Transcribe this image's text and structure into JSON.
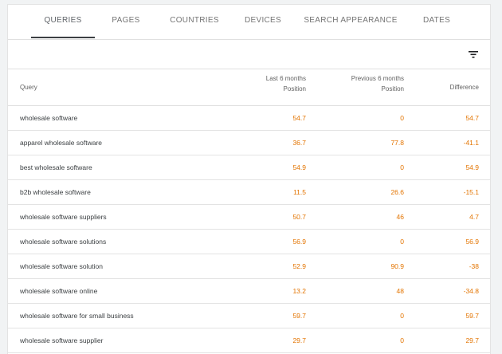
{
  "tabs": [
    {
      "label": "QUERIES",
      "active": true
    },
    {
      "label": "PAGES",
      "active": false
    },
    {
      "label": "COUNTRIES",
      "active": false
    },
    {
      "label": "DEVICES",
      "active": false
    },
    {
      "label": "SEARCH APPEARANCE",
      "active": false
    },
    {
      "label": "DATES",
      "active": false
    }
  ],
  "toolbar": {
    "filter_icon": "filter-list-icon"
  },
  "table": {
    "headers": {
      "query": "Query",
      "last_line1": "Last 6 months",
      "last_line2": "Position",
      "prev_line1": "Previous 6 months",
      "prev_line2": "Position",
      "difference": "Difference"
    },
    "rows": [
      {
        "query": "wholesale software",
        "last": "54.7",
        "prev": "0",
        "diff": "54.7"
      },
      {
        "query": "apparel wholesale software",
        "last": "36.7",
        "prev": "77.8",
        "diff": "-41.1"
      },
      {
        "query": "best wholesale software",
        "last": "54.9",
        "prev": "0",
        "diff": "54.9"
      },
      {
        "query": "b2b wholesale software",
        "last": "11.5",
        "prev": "26.6",
        "diff": "-15.1"
      },
      {
        "query": "wholesale software suppliers",
        "last": "50.7",
        "prev": "46",
        "diff": "4.7"
      },
      {
        "query": "wholesale software solutions",
        "last": "56.9",
        "prev": "0",
        "diff": "56.9"
      },
      {
        "query": "wholesale software solution",
        "last": "52.9",
        "prev": "90.9",
        "diff": "-38"
      },
      {
        "query": "wholesale software online",
        "last": "13.2",
        "prev": "48",
        "diff": "-34.8"
      },
      {
        "query": "wholesale software for small business",
        "last": "59.7",
        "prev": "0",
        "diff": "59.7"
      },
      {
        "query": "wholesale software supplier",
        "last": "29.7",
        "prev": "0",
        "diff": "29.7"
      }
    ]
  },
  "colors": {
    "value": "#e37400",
    "text": "#3c4043",
    "indicator": "#3c4043"
  }
}
